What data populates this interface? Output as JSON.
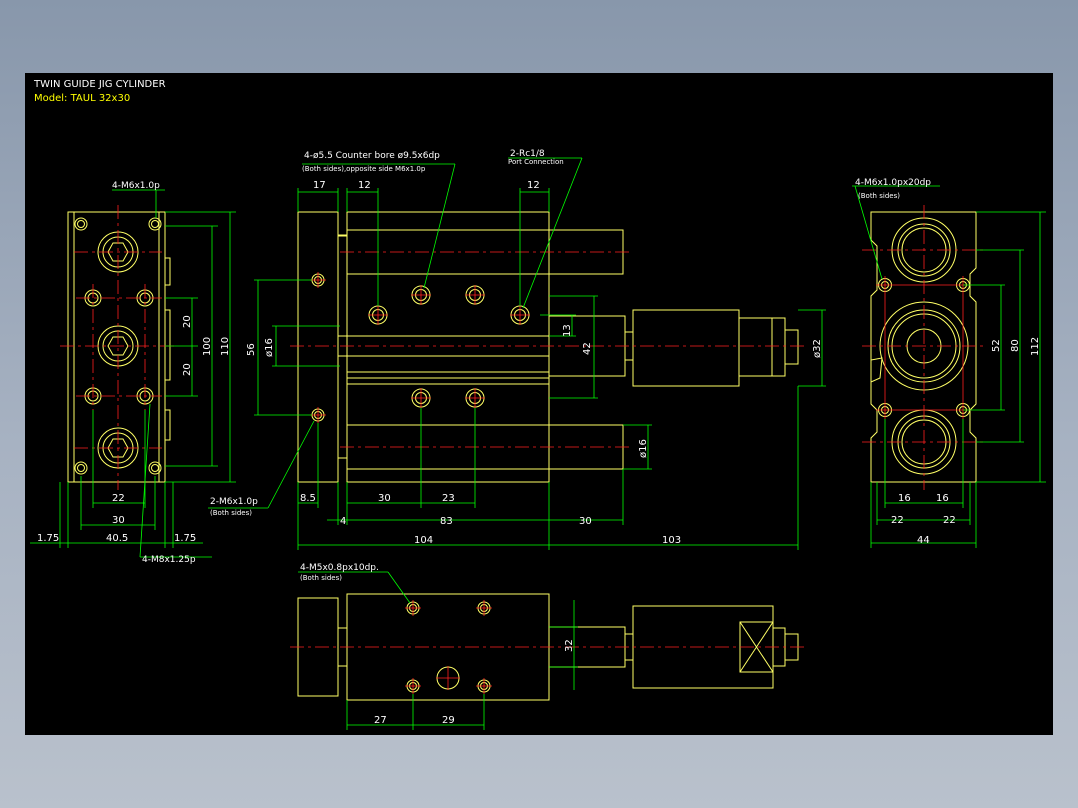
{
  "title_block": {
    "title": "TWIN GUIDE JIG CYLINDER",
    "model": "Model: TAUL 32x30"
  },
  "left_view": {
    "callouts": {
      "top": "4-M6x1.0p",
      "bottom": "4-M8x1.25p"
    },
    "dims": {
      "d20a": "20",
      "d20b": "20",
      "d100": "100",
      "d110": "110",
      "d22": "22",
      "d30": "30",
      "d405": "40.5",
      "d175l": "1.75",
      "d175r": "1.75"
    }
  },
  "front_view": {
    "callouts": {
      "counterbore_line1": "4-ø5.5  Counter bore ø9.5x6dp",
      "counterbore_line2": "(Both sides),opposite side M6x1.0p",
      "port_line1": "2-Rc1/8",
      "port_line2": "Port Connection",
      "side_tap_line1": "2-M6x1.0p",
      "side_tap_line2": "(Both sides)"
    },
    "dims": {
      "d17": "17",
      "d12a": "12",
      "d12b": "12",
      "d56": "56",
      "d16a": "ø16",
      "d13": "13",
      "d42": "42",
      "d32": "ø32",
      "d16b": "ø16",
      "d85": "8.5",
      "d30a": "30",
      "d23": "23",
      "d4": "4",
      "d83": "83",
      "d30b": "30",
      "d104": "104",
      "d103": "103"
    }
  },
  "right_view": {
    "callouts": {
      "line1": "4-M6x1.0px20dp",
      "line2": "(Both sides)"
    },
    "dims": {
      "d52": "52",
      "d80": "80",
      "d112": "112",
      "d16a": "16",
      "d16b": "16",
      "d22a": "22",
      "d22b": "22",
      "d44": "44"
    }
  },
  "top_view": {
    "callouts": {
      "line1": "4-M5x0.8px10dp.",
      "line2": "(Both sides)"
    },
    "dims": {
      "d32": "32",
      "d27": "27",
      "d29": "29"
    }
  },
  "colors": {
    "outline": "#ffff66",
    "dimension": "#00ff00",
    "centerline": "#ff2020",
    "text": "#ffffff",
    "background": "#000000"
  }
}
